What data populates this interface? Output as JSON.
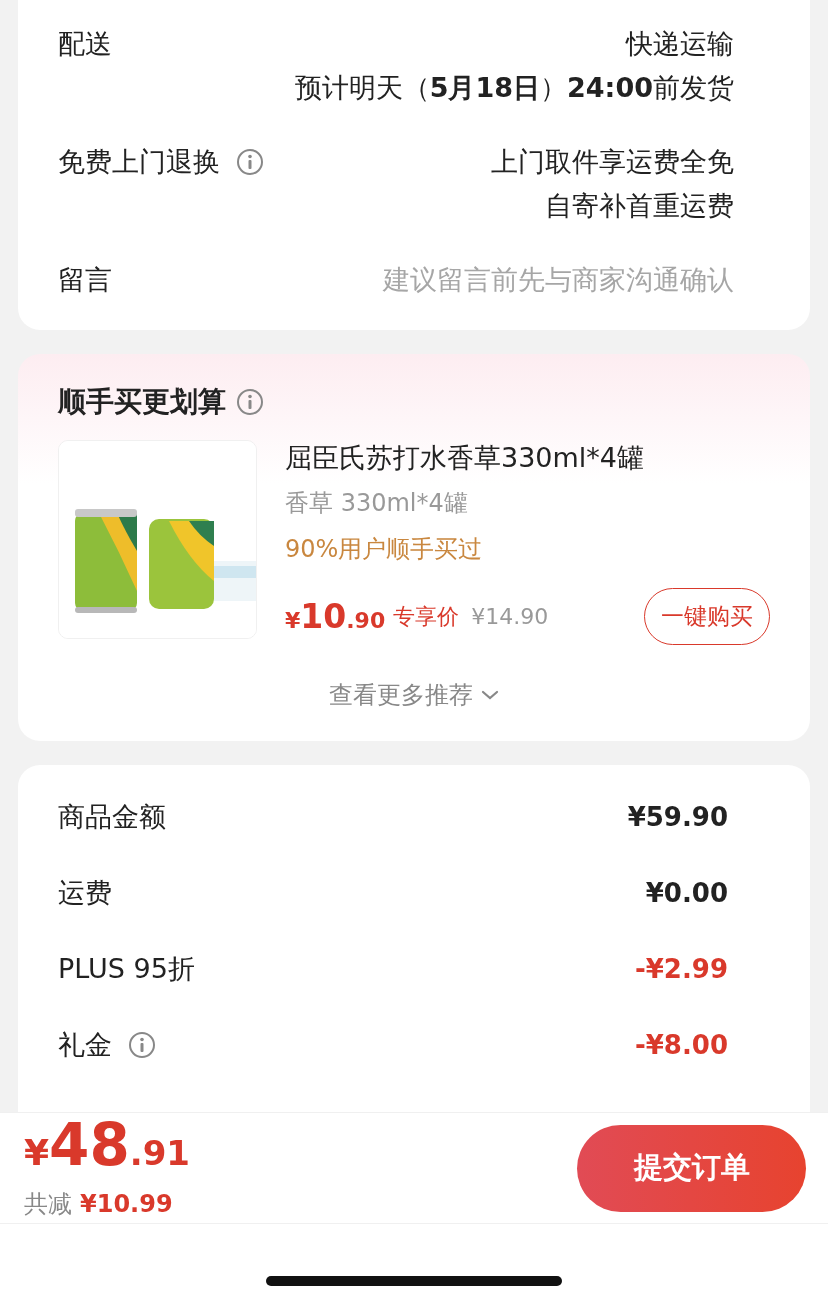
{
  "delivery_card": {
    "rows": [
      {
        "kind": "lines",
        "label": "配送",
        "info": false,
        "lines": [
          "快递运输",
          "预计明天（**5月18日**）**24:00**前发货"
        ]
      },
      {
        "kind": "lines",
        "label": "免费上门退换",
        "info": true,
        "lines": [
          "上门取件享运费全免",
          "自寄补首重运费"
        ]
      },
      {
        "kind": "field",
        "label": "留言",
        "info": false,
        "placeholder": "建议留言前先与商家沟通确认"
      }
    ]
  },
  "recommend_card": {
    "title": "顺手买更划算",
    "info": true,
    "product": {
      "kind": "picture",
      "name": "屈臣氏苏打水香草330ml*4罐",
      "variant": "香草 330ml*4罐",
      "social_proof": "90%用户顺手买过",
      "price": "¥10.90",
      "price_tag": "专享价",
      "original_price": "¥14.90",
      "button": "一键购买"
    },
    "more": "查看更多推荐"
  },
  "summary_card": {
    "rows": [
      {
        "label": "商品金额",
        "info": false,
        "kind": "charge",
        "value": "¥59.90"
      },
      {
        "label": "运费",
        "info": false,
        "kind": "charge",
        "value": "¥0.00"
      },
      {
        "label": "PLUS 95折",
        "info": false,
        "kind": "discount",
        "value": "-¥2.99"
      },
      {
        "label": "礼金",
        "info": true,
        "kind": "discount",
        "value": "-¥8.00"
      }
    ]
  },
  "bottom_bar": {
    "total": "¥48.91",
    "saved_label": "共减",
    "saved_value": "¥10.99",
    "submit": "提交订单"
  }
}
